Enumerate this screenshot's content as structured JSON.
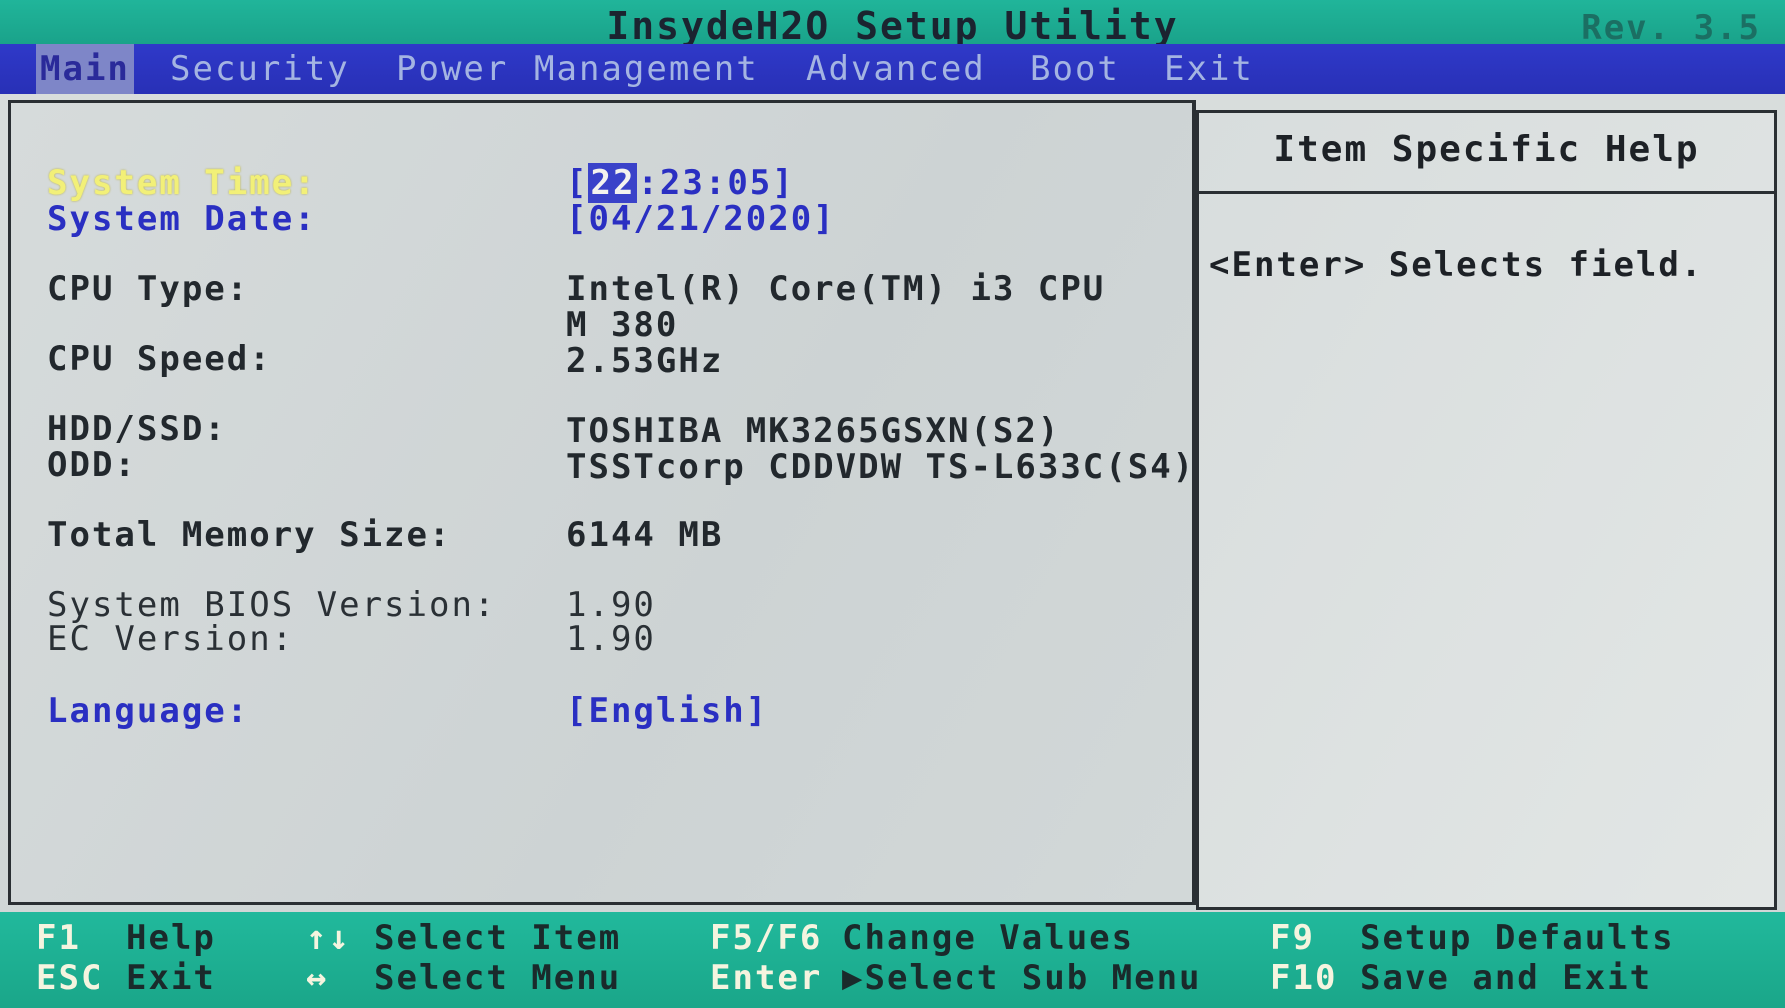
{
  "window": {
    "title": "InsydeH2O Setup Utility",
    "revision": "Rev. 3.5"
  },
  "menu": {
    "items": [
      "Main",
      "Security",
      "Power",
      "Management",
      "Advanced",
      "Boot",
      "Exit"
    ],
    "active": "Main"
  },
  "main": {
    "system_time": {
      "label": "System Time:",
      "value": "[22:23:05]",
      "hour": "22"
    },
    "system_date": {
      "label": "System Date:",
      "value": "[04/21/2020]"
    },
    "cpu_type": {
      "label": "CPU Type:",
      "value_line1": "Intel(R) Core(TM) i3 CPU",
      "value_line2": "M 380"
    },
    "cpu_speed": {
      "label": "CPU Speed:",
      "value": "2.53GHz"
    },
    "hdd": {
      "label": "HDD/SSD:",
      "value": "TOSHIBA MK3265GSXN(S2)"
    },
    "odd": {
      "label": "ODD:",
      "value": "TSSTcorp CDDVDW TS-L633C(S4)"
    },
    "memory": {
      "label": "Total Memory Size:",
      "value": "6144 MB"
    },
    "bios_version": {
      "label": "System BIOS Version:",
      "value": "1.90"
    },
    "ec_version": {
      "label": "EC Version:",
      "value": "1.90"
    },
    "language": {
      "label": "Language:",
      "value": "[English]"
    }
  },
  "help": {
    "title": "Item Specific Help",
    "text": "<Enter> Selects field."
  },
  "footer": {
    "f1_key": "F1",
    "f1_desc": "Help",
    "esc_key": "ESC",
    "esc_desc": "Exit",
    "updown_key": "↑↓",
    "updown_desc": "Select Item",
    "leftright_key": "↔",
    "leftright_desc": "Select Menu",
    "f5f6_key": "F5/F6",
    "f5f6_desc": "Change Values",
    "enter_key": "Enter",
    "enter_desc": "▶Select Sub Menu",
    "f9_key": "F9",
    "f9_desc": "Setup Defaults",
    "f10_key": "F10",
    "f10_desc": "Save and Exit"
  },
  "colors": {
    "title_bar": "#1fb39a",
    "menu_bar": "#2b34c2",
    "selected_label": "#f2f078",
    "highlight_blue": "#2a2fc2",
    "panel_bg": "#d3d9d9"
  }
}
